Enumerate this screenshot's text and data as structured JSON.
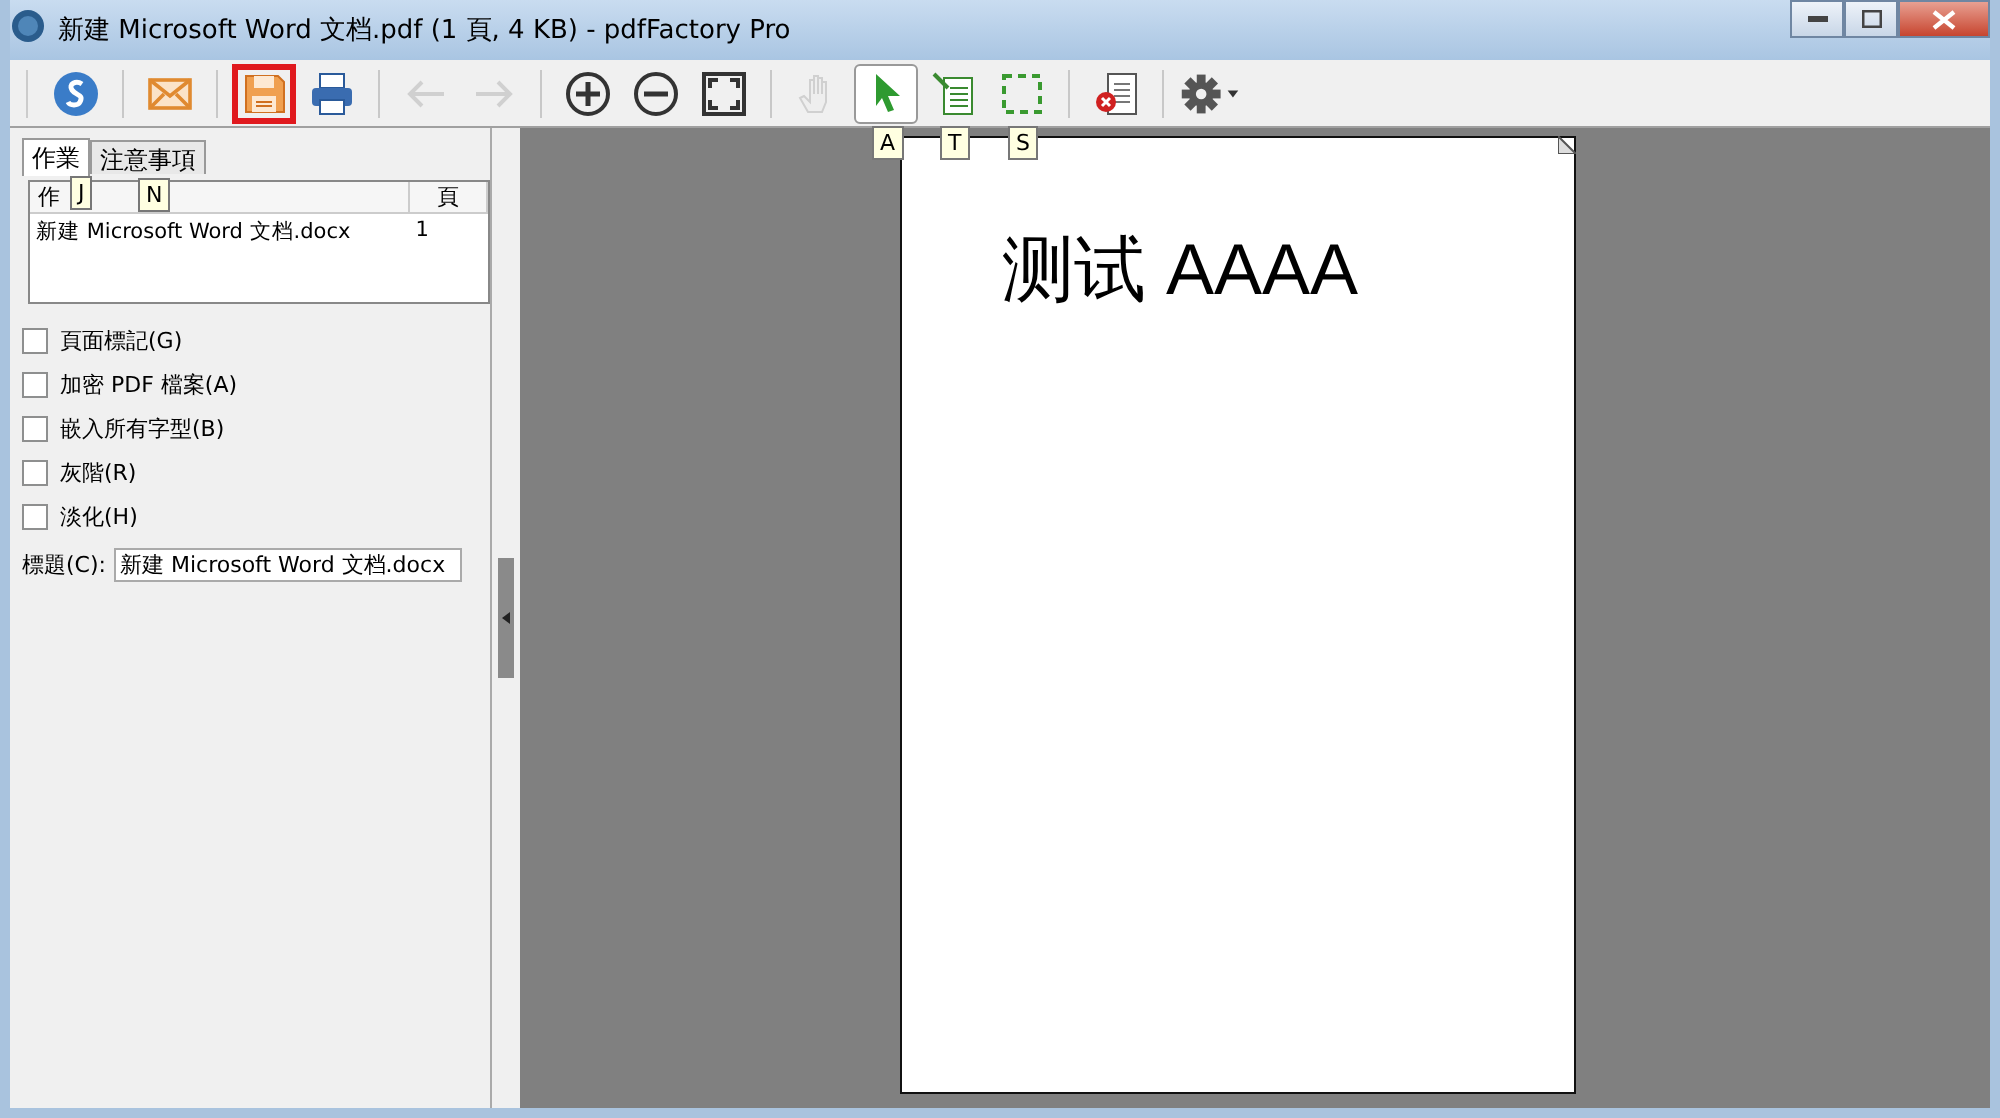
{
  "window": {
    "title": "新建 Microsoft Word 文档.pdf (1 頁, 4 KB) - pdfFactory Pro"
  },
  "toolbar": [
    {
      "disabled": false,
      "selected": false,
      "highlighted": false
    },
    {
      "disabled": false,
      "selected": false,
      "highlighted": false
    },
    {
      "disabled": false,
      "selected": false,
      "highlighted": true
    },
    {
      "disabled": false,
      "selected": false,
      "highlighted": false
    },
    {
      "disabled": true,
      "selected": false,
      "highlighted": false
    },
    {
      "disabled": true,
      "selected": false,
      "highlighted": false
    },
    {
      "disabled": false,
      "selected": false,
      "highlighted": false
    },
    {
      "disabled": false,
      "selected": false,
      "highlighted": false
    },
    {
      "disabled": false,
      "selected": false,
      "highlighted": false
    },
    {
      "disabled": true,
      "selected": false,
      "highlighted": false
    },
    {
      "disabled": false,
      "selected": true,
      "highlighted": false,
      "key_tip": "A"
    },
    {
      "disabled": false,
      "selected": false,
      "highlighted": false,
      "key_tip": "T"
    },
    {
      "disabled": false,
      "selected": false,
      "highlighted": false,
      "key_tip": "S"
    },
    {
      "disabled": false,
      "selected": false,
      "highlighted": false
    },
    {
      "disabled": false,
      "selected": false,
      "highlighted": false
    }
  ],
  "tabs": [
    {
      "label": "作業",
      "selected": true,
      "key_tip": "J"
    },
    {
      "label": "注意事項",
      "selected": false,
      "key_tip": "N"
    }
  ],
  "jobs": {
    "columns": [
      "作",
      "頁"
    ],
    "rows": [
      {
        "name": "新建 Microsoft Word 文档.docx",
        "pages": "1"
      }
    ]
  },
  "options": [
    {
      "label": "頁面標記(G)",
      "checked": false
    },
    {
      "label": "加密 PDF 檔案(A)",
      "checked": false
    },
    {
      "label": "嵌入所有字型(B)",
      "checked": false
    },
    {
      "label": "灰階(R)",
      "checked": false
    },
    {
      "label": "淡化(H)",
      "checked": false
    }
  ],
  "title_field": {
    "label": "標題(C):",
    "value": "新建 Microsoft Word 文档.docx"
  },
  "page": {
    "text": "测试 AAAA"
  }
}
